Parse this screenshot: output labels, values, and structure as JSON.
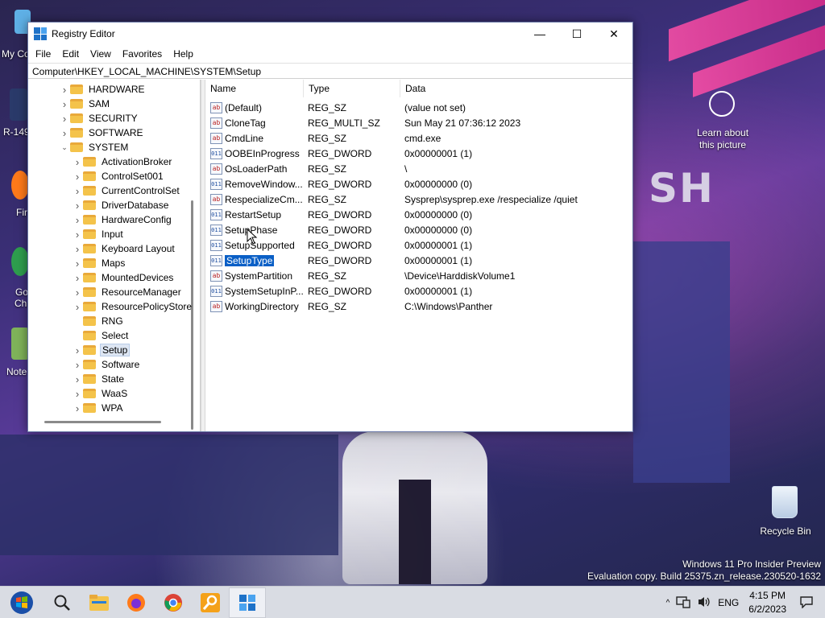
{
  "window": {
    "title": "Registry Editor",
    "minimize_glyph": "—",
    "maximize_glyph": "☐",
    "close_glyph": "✕"
  },
  "menu": [
    "File",
    "Edit",
    "View",
    "Favorites",
    "Help"
  ],
  "address": "Computer\\HKEY_LOCAL_MACHINE\\SYSTEM\\Setup",
  "tree": {
    "items": [
      {
        "label": "HARDWARE",
        "level": 1,
        "expanded": false,
        "selected": false
      },
      {
        "label": "SAM",
        "level": 1,
        "expanded": false,
        "selected": false
      },
      {
        "label": "SECURITY",
        "level": 1,
        "expanded": false,
        "selected": false
      },
      {
        "label": "SOFTWARE",
        "level": 1,
        "expanded": false,
        "selected": false
      },
      {
        "label": "SYSTEM",
        "level": 1,
        "expanded": true,
        "selected": false
      },
      {
        "label": "ActivationBroker",
        "level": 2,
        "expanded": false,
        "selected": false
      },
      {
        "label": "ControlSet001",
        "level": 2,
        "expanded": false,
        "selected": false
      },
      {
        "label": "CurrentControlSet",
        "level": 2,
        "expanded": false,
        "selected": false
      },
      {
        "label": "DriverDatabase",
        "level": 2,
        "expanded": false,
        "selected": false
      },
      {
        "label": "HardwareConfig",
        "level": 2,
        "expanded": false,
        "selected": false
      },
      {
        "label": "Input",
        "level": 2,
        "expanded": false,
        "selected": false
      },
      {
        "label": "Keyboard Layout",
        "level": 2,
        "expanded": false,
        "selected": false
      },
      {
        "label": "Maps",
        "level": 2,
        "expanded": false,
        "selected": false
      },
      {
        "label": "MountedDevices",
        "level": 2,
        "expanded": false,
        "selected": false
      },
      {
        "label": "ResourceManager",
        "level": 2,
        "expanded": false,
        "selected": false
      },
      {
        "label": "ResourcePolicyStore",
        "level": 2,
        "expanded": false,
        "selected": false
      },
      {
        "label": "RNG",
        "level": 2,
        "expanded": null,
        "selected": false
      },
      {
        "label": "Select",
        "level": 2,
        "expanded": null,
        "selected": false
      },
      {
        "label": "Setup",
        "level": 2,
        "expanded": false,
        "selected": true
      },
      {
        "label": "Software",
        "level": 2,
        "expanded": false,
        "selected": false
      },
      {
        "label": "State",
        "level": 2,
        "expanded": false,
        "selected": false
      },
      {
        "label": "WaaS",
        "level": 2,
        "expanded": false,
        "selected": false
      },
      {
        "label": "WPA",
        "level": 2,
        "expanded": false,
        "selected": false
      }
    ]
  },
  "list": {
    "columns": [
      "Name",
      "Type",
      "Data"
    ],
    "rows": [
      {
        "name": "(Default)",
        "type": "REG_SZ",
        "data": "(value not set)",
        "icon": "string-value-icon",
        "selected": false
      },
      {
        "name": "CloneTag",
        "type": "REG_MULTI_SZ",
        "data": "Sun May 21 07:36:12 2023",
        "icon": "string-value-icon",
        "selected": false
      },
      {
        "name": "CmdLine",
        "type": "REG_SZ",
        "data": "cmd.exe",
        "icon": "string-value-icon",
        "selected": false
      },
      {
        "name": "OOBEInProgress",
        "type": "REG_DWORD",
        "data": "0x00000001 (1)",
        "icon": "binary-value-icon",
        "selected": false
      },
      {
        "name": "OsLoaderPath",
        "type": "REG_SZ",
        "data": "\\",
        "icon": "string-value-icon",
        "selected": false
      },
      {
        "name": "RemoveWindow...",
        "type": "REG_DWORD",
        "data": "0x00000000 (0)",
        "icon": "binary-value-icon",
        "selected": false
      },
      {
        "name": "RespecializeCm...",
        "type": "REG_SZ",
        "data": "Sysprep\\sysprep.exe /respecialize /quiet",
        "icon": "string-value-icon",
        "selected": false
      },
      {
        "name": "RestartSetup",
        "type": "REG_DWORD",
        "data": "0x00000000 (0)",
        "icon": "binary-value-icon",
        "selected": false
      },
      {
        "name": "SetupPhase",
        "type": "REG_DWORD",
        "data": "0x00000000 (0)",
        "icon": "binary-value-icon",
        "selected": false
      },
      {
        "name": "SetupSupported",
        "type": "REG_DWORD",
        "data": "0x00000001 (1)",
        "icon": "binary-value-icon",
        "selected": false
      },
      {
        "name": "SetupType",
        "type": "REG_DWORD",
        "data": "0x00000001 (1)",
        "icon": "binary-value-icon",
        "selected": true
      },
      {
        "name": "SystemPartition",
        "type": "REG_SZ",
        "data": "\\Device\\HarddiskVolume1",
        "icon": "string-value-icon",
        "selected": false
      },
      {
        "name": "SystemSetupInP...",
        "type": "REG_DWORD",
        "data": "0x00000001 (1)",
        "icon": "binary-value-icon",
        "selected": false
      },
      {
        "name": "WorkingDirectory",
        "type": "REG_SZ",
        "data": "C:\\Windows\\Panther",
        "icon": "string-value-icon",
        "selected": false
      }
    ],
    "string_icon_glyph": "ab",
    "binary_icon_glyph": "011"
  },
  "desktop": {
    "left_labels": [
      "My Co",
      "R-149",
      "Fir",
      "Go Chi",
      "Note"
    ],
    "spotlight_label": "Learn about this picture",
    "recycle_label": "Recycle Bin",
    "wallpaper_text": "SH"
  },
  "watermark": {
    "line1": "Windows 11 Pro Insider Preview",
    "line2": "Evaluation copy. Build 25375.zn_release.230520-1632"
  },
  "taskbar": {
    "items": [
      "start-button",
      "search-icon",
      "file-explorer-icon",
      "firefox-icon",
      "chrome-icon",
      "search-app-icon",
      "registry-editor-icon"
    ],
    "tray": {
      "chevron": "^",
      "language": "ENG",
      "time": "4:15 PM",
      "date": "6/2/2023"
    }
  }
}
